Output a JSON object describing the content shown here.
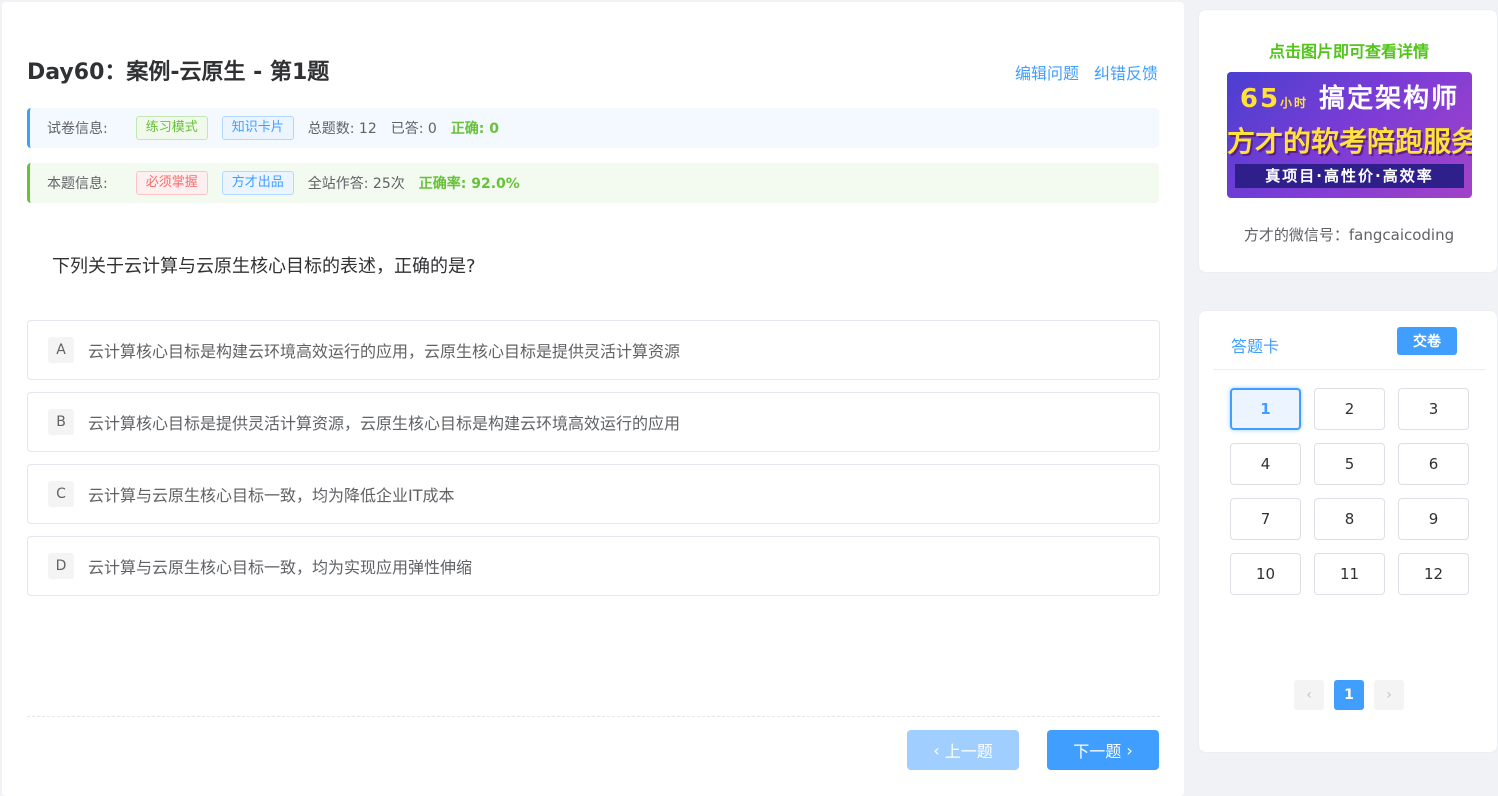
{
  "header": {
    "title": "Day60：案例-云原生 - 第1题",
    "edit_link": "编辑问题",
    "feedback_link": "纠错反馈"
  },
  "paper_info": {
    "label": "试卷信息:",
    "mode_tag": "练习模式",
    "card_tag": "知识卡片",
    "total": "总题数: 12",
    "answered": "已答: 0",
    "correct": "正确: 0"
  },
  "question_info": {
    "label": "本题信息:",
    "must_tag": "必须掌握",
    "source_tag": "方才出品",
    "attempts": "全站作答: 25次",
    "accuracy": "正确率: 92.0%"
  },
  "question": {
    "text": "下列关于云计算与云原生核心目标的表述，正确的是?",
    "options": [
      {
        "letter": "A",
        "text": "云计算核心目标是构建云环境高效运行的应用，云原生核心目标是提供灵活计算资源"
      },
      {
        "letter": "B",
        "text": "云计算核心目标是提供灵活计算资源，云原生核心目标是构建云环境高效运行的应用"
      },
      {
        "letter": "C",
        "text": "云计算与云原生核心目标一致，均为降低企业IT成本"
      },
      {
        "letter": "D",
        "text": "云计算与云原生核心目标一致，均为实现应用弹性伸缩"
      }
    ]
  },
  "nav": {
    "prev": "上一题",
    "next": "下一题"
  },
  "ad": {
    "title": "点击图片即可查看详情",
    "banner_hours": "65",
    "banner_unit": "小时",
    "banner_line1_rest": " 搞定架构师",
    "banner_line2": "方才的软考陪跑服务",
    "banner_line3": "真项目·高性价·高效率",
    "wechat": "方才的微信号：fangcaicoding"
  },
  "answer_card": {
    "title": "答题卡",
    "submit": "交卷",
    "numbers": [
      "1",
      "2",
      "3",
      "4",
      "5",
      "6",
      "7",
      "8",
      "9",
      "10",
      "11",
      "12"
    ],
    "current_page": "1"
  },
  "colors": {
    "primary": "#409eff",
    "success": "#67c23a",
    "danger": "#f56c6c"
  }
}
